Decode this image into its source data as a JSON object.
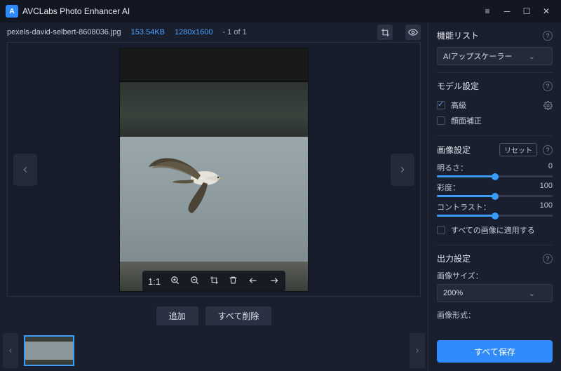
{
  "app": {
    "title": "AVCLabs Photo Enhancer AI"
  },
  "file": {
    "name": "pexels-david-selbert-8608036.jpg",
    "size": "153.54KB",
    "dimensions": "1280x1600",
    "index": "- 1 of 1"
  },
  "tools": {
    "fit": "1:1"
  },
  "buttons": {
    "add": "追加",
    "delete_all": "すべて削除",
    "save_all": "すべて保存"
  },
  "features": {
    "title": "機能リスト",
    "selected": "AIアップスケーラー"
  },
  "model": {
    "title": "モデル設定",
    "advanced": "高級",
    "face_fix": "顔面補正"
  },
  "image_settings": {
    "title": "画像設定",
    "reset": "リセット",
    "brightness_label": "明るさ：",
    "brightness_value": "0",
    "saturation_label": "彩度：",
    "saturation_value": "100",
    "contrast_label": "コントラスト：",
    "contrast_value": "100",
    "apply_all": "すべての画像に適用する"
  },
  "output": {
    "title": "出力設定",
    "size_label": "画像サイズ：",
    "size_value": "200%",
    "format_label": "画像形式："
  }
}
